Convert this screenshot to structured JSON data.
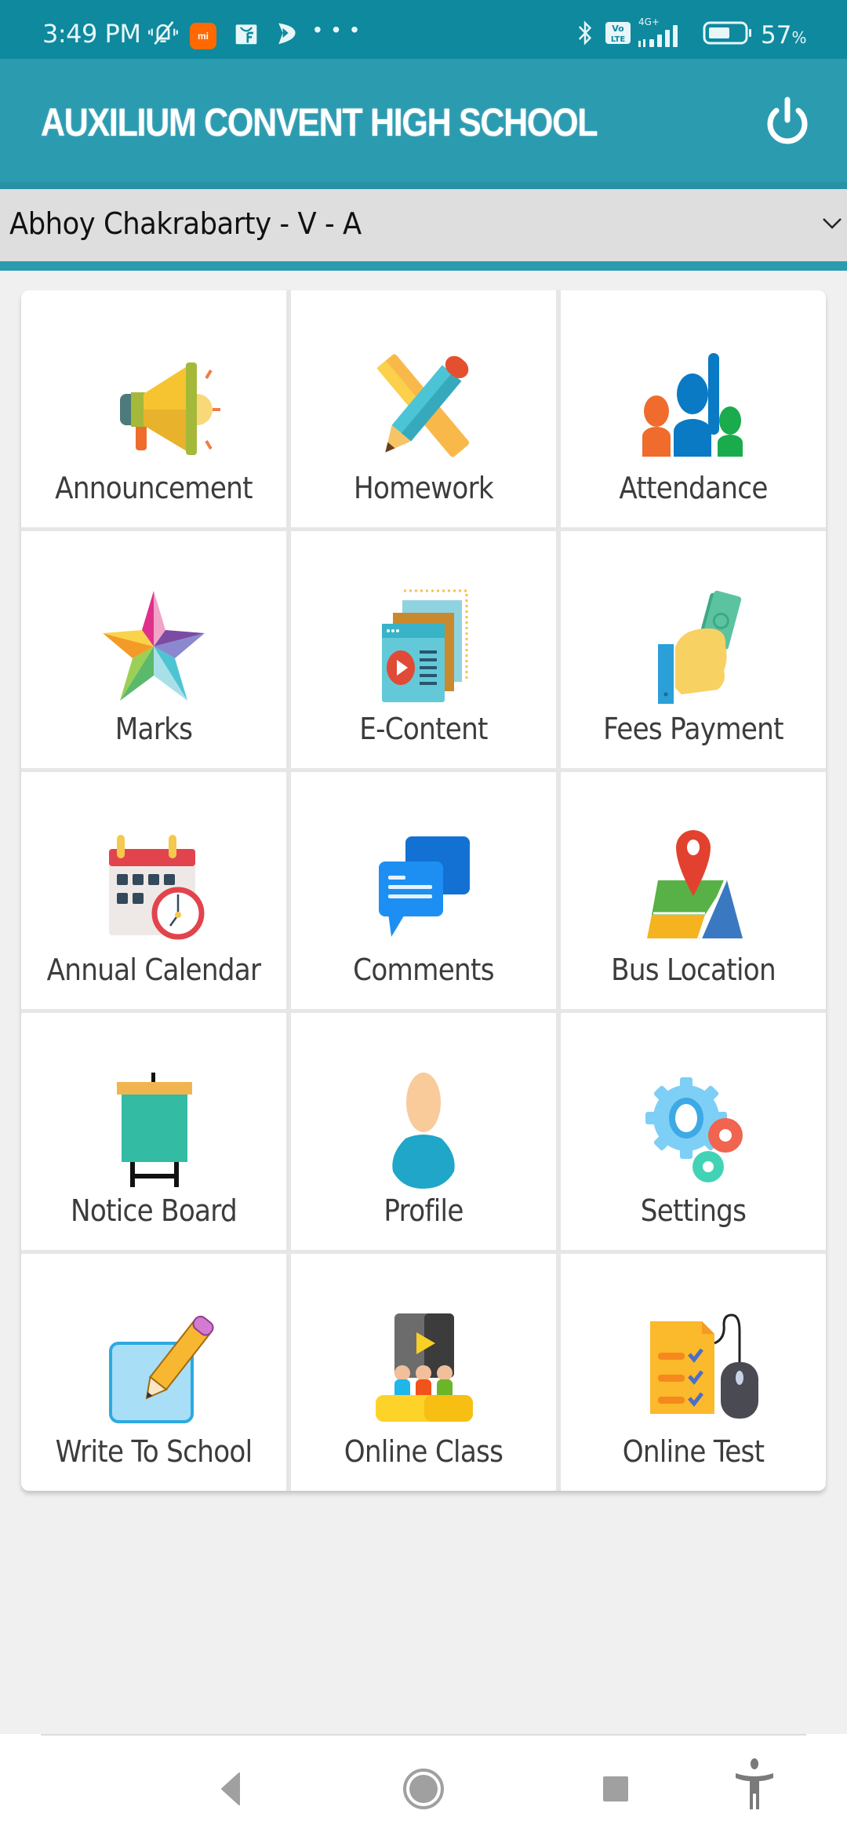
{
  "status_bar": {
    "time": "3:49 PM",
    "notification_icons": [
      "mute-bell-icon",
      "mi-icon",
      "shopping-bag-icon",
      "play-app-icon"
    ],
    "mi_label": "mi",
    "more": "• • •",
    "system_icons": [
      "bluetooth-icon",
      "volte-icon",
      "signal-4g-plus-icon",
      "battery-icon"
    ],
    "network_label": "4G+",
    "volte_label": "Vo LTE",
    "battery_percent": "57",
    "battery_level": 0.57,
    "percent_sign": "%"
  },
  "header": {
    "title": "AUXILIUM CONVENT HIGH SCHOOL",
    "power_icon": "power-icon",
    "color": "#2b9bb0"
  },
  "student_selector": {
    "selected": "Abhoy Chakrabarty - V - A",
    "icon": "chevron-down-icon"
  },
  "menu": {
    "tiles": [
      {
        "label": "Announcement",
        "icon": "megaphone-icon"
      },
      {
        "label": "Homework",
        "icon": "pencil-ruler-icon"
      },
      {
        "label": "Attendance",
        "icon": "raised-hand-people-icon"
      },
      {
        "label": "Marks",
        "icon": "star-icon"
      },
      {
        "label": "E-Content",
        "icon": "video-content-icon"
      },
      {
        "label": "Fees Payment",
        "icon": "hand-money-icon"
      },
      {
        "label": "Annual Calendar",
        "icon": "calendar-clock-icon"
      },
      {
        "label": "Comments",
        "icon": "chat-bubbles-icon"
      },
      {
        "label": "Bus Location",
        "icon": "map-pin-icon"
      },
      {
        "label": "Notice Board",
        "icon": "notice-board-icon"
      },
      {
        "label": "Profile",
        "icon": "user-icon"
      },
      {
        "label": "Settings",
        "icon": "gears-icon"
      },
      {
        "label": "Write To School",
        "icon": "write-note-icon"
      },
      {
        "label": "Online Class",
        "icon": "online-class-icon"
      },
      {
        "label": "Online Test",
        "icon": "online-test-icon"
      }
    ]
  },
  "nav_bar": {
    "buttons": [
      "back-icon",
      "home-icon",
      "recents-icon",
      "accessibility-icon"
    ]
  }
}
